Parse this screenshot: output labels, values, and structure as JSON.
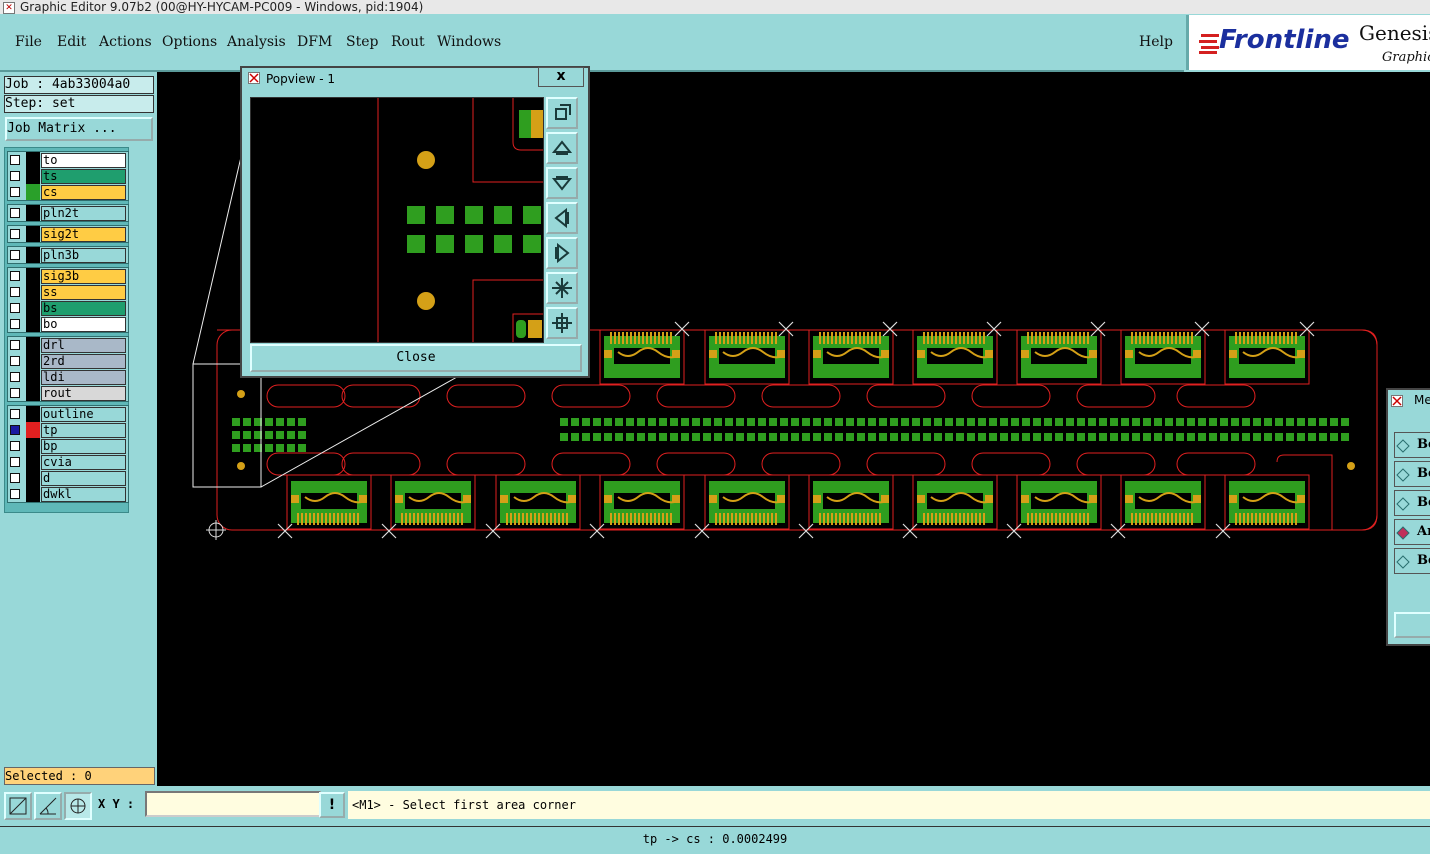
{
  "window": {
    "title": "Graphic Editor 9.07b2 (00@HY-HYCAM-PC009 - Windows, pid:1904)"
  },
  "menu": {
    "items": [
      "File",
      "Edit",
      "Actions",
      "Options",
      "Analysis",
      "DFM",
      "Step",
      "Rout",
      "Windows"
    ],
    "help": "Help"
  },
  "logo": {
    "brand": "Frontline",
    "product": "Genesis",
    "subtitle": "Graphic"
  },
  "job": {
    "label": "Job : 4ab33004a0",
    "step": "Step: set",
    "matrix_button": "Job Matrix ..."
  },
  "layers": [
    {
      "name": "to",
      "bg": "#ffffff",
      "swatch": "#000000"
    },
    {
      "name": "ts",
      "bg": "#1f9e6e",
      "swatch": "#000000"
    },
    {
      "name": "cs",
      "bg": "#ffcc44",
      "swatch": "#2aa02a"
    },
    {
      "name": "pln2t",
      "bg": "#98d8d8",
      "swatch": "#000000"
    },
    {
      "name": "sig2t",
      "bg": "#ffcc44",
      "swatch": "#000000"
    },
    {
      "name": "pln3b",
      "bg": "#98d8d8",
      "swatch": "#000000"
    },
    {
      "name": "sig3b",
      "bg": "#ffcc44",
      "swatch": "#000000"
    },
    {
      "name": "ss",
      "bg": "#ffcc44",
      "swatch": "#000000"
    },
    {
      "name": "bs",
      "bg": "#1f9e6e",
      "swatch": "#000000"
    },
    {
      "name": "bo",
      "bg": "#ffffff",
      "swatch": "#000000"
    },
    {
      "name": "drl",
      "bg": "#a9b8c8",
      "swatch": "#000000"
    },
    {
      "name": "2rd",
      "bg": "#a9b8c8",
      "swatch": "#000000"
    },
    {
      "name": "ldi",
      "bg": "#a9b8c8",
      "swatch": "#000000"
    },
    {
      "name": "rout",
      "bg": "#d8d8d8",
      "swatch": "#000000"
    },
    {
      "name": "outline",
      "bg": "#98d8d8",
      "swatch": "#000000"
    },
    {
      "name": "tp",
      "bg": "#98d8d8",
      "swatch": "#e02020",
      "active": true
    },
    {
      "name": "bp",
      "bg": "#98d8d8",
      "swatch": "#000000"
    },
    {
      "name": "cvia",
      "bg": "#98d8d8",
      "swatch": "#000000"
    },
    {
      "name": "d",
      "bg": "#98d8d8",
      "swatch": "#000000"
    },
    {
      "name": "dwkl",
      "bg": "#98d8d8",
      "swatch": "#000000"
    }
  ],
  "selected": "Selected : 0",
  "bottom": {
    "xy_label": "X Y :",
    "xy_value": "",
    "warn": "!",
    "prompt": "<M1> - Select first area corner"
  },
  "status": "tp -> cs : 0.0002499",
  "popview": {
    "title": "Popview - 1",
    "close_x": "x",
    "close_button": "Close"
  },
  "right_panel": {
    "title": "Me",
    "items": [
      "Be",
      "Be",
      "Be",
      "An",
      "Be"
    ]
  },
  "colors": {
    "copper": "#d4a017",
    "pad": "#2f9e1f",
    "outline": "#e02020",
    "background": "#000000",
    "accent": "#98d8d8"
  }
}
